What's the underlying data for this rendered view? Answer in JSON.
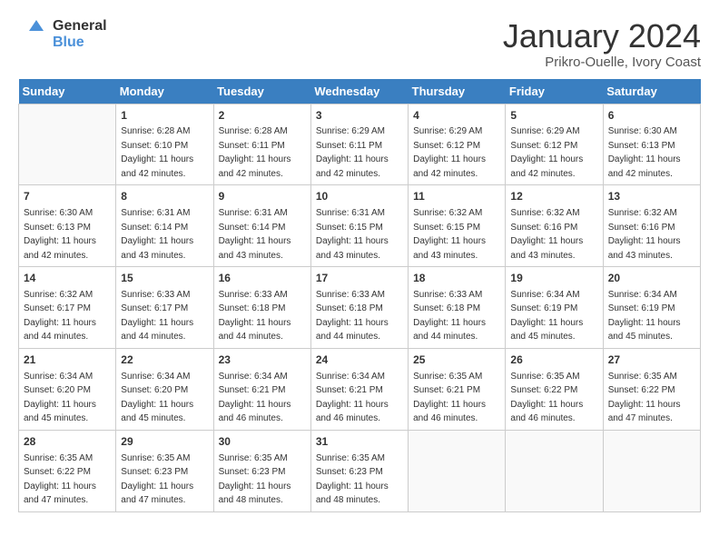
{
  "logo": {
    "line1": "General",
    "line2": "Blue"
  },
  "title": "January 2024",
  "subtitle": "Prikro-Ouelle, Ivory Coast",
  "days_header": [
    "Sunday",
    "Monday",
    "Tuesday",
    "Wednesday",
    "Thursday",
    "Friday",
    "Saturday"
  ],
  "weeks": [
    [
      {
        "day": "",
        "sunrise": "",
        "sunset": "",
        "daylight": ""
      },
      {
        "day": "1",
        "sunrise": "Sunrise: 6:28 AM",
        "sunset": "Sunset: 6:10 PM",
        "daylight": "Daylight: 11 hours and 42 minutes."
      },
      {
        "day": "2",
        "sunrise": "Sunrise: 6:28 AM",
        "sunset": "Sunset: 6:11 PM",
        "daylight": "Daylight: 11 hours and 42 minutes."
      },
      {
        "day": "3",
        "sunrise": "Sunrise: 6:29 AM",
        "sunset": "Sunset: 6:11 PM",
        "daylight": "Daylight: 11 hours and 42 minutes."
      },
      {
        "day": "4",
        "sunrise": "Sunrise: 6:29 AM",
        "sunset": "Sunset: 6:12 PM",
        "daylight": "Daylight: 11 hours and 42 minutes."
      },
      {
        "day": "5",
        "sunrise": "Sunrise: 6:29 AM",
        "sunset": "Sunset: 6:12 PM",
        "daylight": "Daylight: 11 hours and 42 minutes."
      },
      {
        "day": "6",
        "sunrise": "Sunrise: 6:30 AM",
        "sunset": "Sunset: 6:13 PM",
        "daylight": "Daylight: 11 hours and 42 minutes."
      }
    ],
    [
      {
        "day": "7",
        "sunrise": "Sunrise: 6:30 AM",
        "sunset": "Sunset: 6:13 PM",
        "daylight": "Daylight: 11 hours and 42 minutes."
      },
      {
        "day": "8",
        "sunrise": "Sunrise: 6:31 AM",
        "sunset": "Sunset: 6:14 PM",
        "daylight": "Daylight: 11 hours and 43 minutes."
      },
      {
        "day": "9",
        "sunrise": "Sunrise: 6:31 AM",
        "sunset": "Sunset: 6:14 PM",
        "daylight": "Daylight: 11 hours and 43 minutes."
      },
      {
        "day": "10",
        "sunrise": "Sunrise: 6:31 AM",
        "sunset": "Sunset: 6:15 PM",
        "daylight": "Daylight: 11 hours and 43 minutes."
      },
      {
        "day": "11",
        "sunrise": "Sunrise: 6:32 AM",
        "sunset": "Sunset: 6:15 PM",
        "daylight": "Daylight: 11 hours and 43 minutes."
      },
      {
        "day": "12",
        "sunrise": "Sunrise: 6:32 AM",
        "sunset": "Sunset: 6:16 PM",
        "daylight": "Daylight: 11 hours and 43 minutes."
      },
      {
        "day": "13",
        "sunrise": "Sunrise: 6:32 AM",
        "sunset": "Sunset: 6:16 PM",
        "daylight": "Daylight: 11 hours and 43 minutes."
      }
    ],
    [
      {
        "day": "14",
        "sunrise": "Sunrise: 6:32 AM",
        "sunset": "Sunset: 6:17 PM",
        "daylight": "Daylight: 11 hours and 44 minutes."
      },
      {
        "day": "15",
        "sunrise": "Sunrise: 6:33 AM",
        "sunset": "Sunset: 6:17 PM",
        "daylight": "Daylight: 11 hours and 44 minutes."
      },
      {
        "day": "16",
        "sunrise": "Sunrise: 6:33 AM",
        "sunset": "Sunset: 6:18 PM",
        "daylight": "Daylight: 11 hours and 44 minutes."
      },
      {
        "day": "17",
        "sunrise": "Sunrise: 6:33 AM",
        "sunset": "Sunset: 6:18 PM",
        "daylight": "Daylight: 11 hours and 44 minutes."
      },
      {
        "day": "18",
        "sunrise": "Sunrise: 6:33 AM",
        "sunset": "Sunset: 6:18 PM",
        "daylight": "Daylight: 11 hours and 44 minutes."
      },
      {
        "day": "19",
        "sunrise": "Sunrise: 6:34 AM",
        "sunset": "Sunset: 6:19 PM",
        "daylight": "Daylight: 11 hours and 45 minutes."
      },
      {
        "day": "20",
        "sunrise": "Sunrise: 6:34 AM",
        "sunset": "Sunset: 6:19 PM",
        "daylight": "Daylight: 11 hours and 45 minutes."
      }
    ],
    [
      {
        "day": "21",
        "sunrise": "Sunrise: 6:34 AM",
        "sunset": "Sunset: 6:20 PM",
        "daylight": "Daylight: 11 hours and 45 minutes."
      },
      {
        "day": "22",
        "sunrise": "Sunrise: 6:34 AM",
        "sunset": "Sunset: 6:20 PM",
        "daylight": "Daylight: 11 hours and 45 minutes."
      },
      {
        "day": "23",
        "sunrise": "Sunrise: 6:34 AM",
        "sunset": "Sunset: 6:21 PM",
        "daylight": "Daylight: 11 hours and 46 minutes."
      },
      {
        "day": "24",
        "sunrise": "Sunrise: 6:34 AM",
        "sunset": "Sunset: 6:21 PM",
        "daylight": "Daylight: 11 hours and 46 minutes."
      },
      {
        "day": "25",
        "sunrise": "Sunrise: 6:35 AM",
        "sunset": "Sunset: 6:21 PM",
        "daylight": "Daylight: 11 hours and 46 minutes."
      },
      {
        "day": "26",
        "sunrise": "Sunrise: 6:35 AM",
        "sunset": "Sunset: 6:22 PM",
        "daylight": "Daylight: 11 hours and 46 minutes."
      },
      {
        "day": "27",
        "sunrise": "Sunrise: 6:35 AM",
        "sunset": "Sunset: 6:22 PM",
        "daylight": "Daylight: 11 hours and 47 minutes."
      }
    ],
    [
      {
        "day": "28",
        "sunrise": "Sunrise: 6:35 AM",
        "sunset": "Sunset: 6:22 PM",
        "daylight": "Daylight: 11 hours and 47 minutes."
      },
      {
        "day": "29",
        "sunrise": "Sunrise: 6:35 AM",
        "sunset": "Sunset: 6:23 PM",
        "daylight": "Daylight: 11 hours and 47 minutes."
      },
      {
        "day": "30",
        "sunrise": "Sunrise: 6:35 AM",
        "sunset": "Sunset: 6:23 PM",
        "daylight": "Daylight: 11 hours and 48 minutes."
      },
      {
        "day": "31",
        "sunrise": "Sunrise: 6:35 AM",
        "sunset": "Sunset: 6:23 PM",
        "daylight": "Daylight: 11 hours and 48 minutes."
      },
      {
        "day": "",
        "sunrise": "",
        "sunset": "",
        "daylight": ""
      },
      {
        "day": "",
        "sunrise": "",
        "sunset": "",
        "daylight": ""
      },
      {
        "day": "",
        "sunrise": "",
        "sunset": "",
        "daylight": ""
      }
    ]
  ]
}
